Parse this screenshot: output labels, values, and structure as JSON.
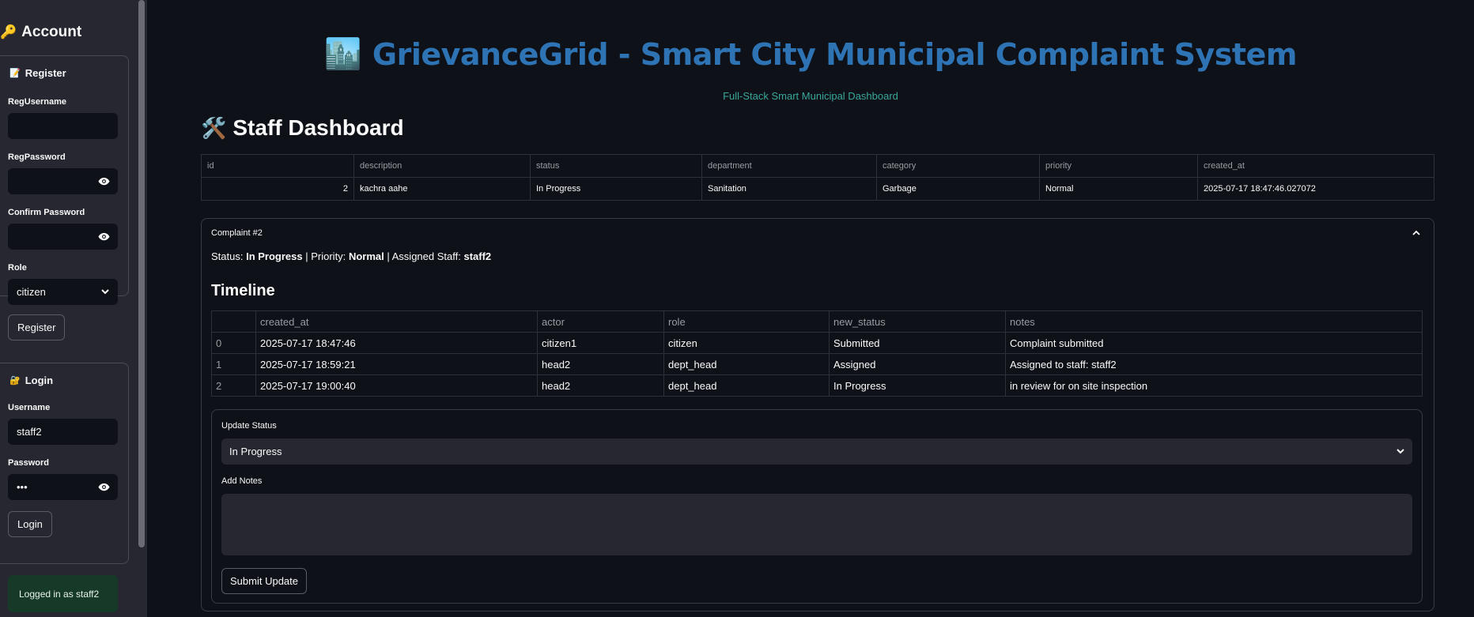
{
  "sidebar": {
    "title": "Account",
    "register": {
      "heading": "Register",
      "reg_username_label": "RegUsername",
      "reg_username_value": "",
      "reg_password_label": "RegPassword",
      "confirm_password_label": "Confirm Password",
      "role_label": "Role",
      "role_value": "citizen",
      "button": "Register"
    },
    "login": {
      "heading": "Login",
      "username_label": "Username",
      "username_value": "staff2",
      "password_label": "Password",
      "password_value": "•••",
      "button": "Login"
    },
    "status": "Logged in as staff2"
  },
  "header": {
    "title": "GrievanceGrid - Smart City Municipal Complaint System",
    "subtitle": "Full-Stack Smart Municipal Dashboard"
  },
  "dashboard": {
    "title": "Staff Dashboard",
    "complaints_table": {
      "columns": [
        "id",
        "description",
        "status",
        "department",
        "category",
        "priority",
        "created_at"
      ],
      "rows": [
        [
          "2",
          "kachra aahe",
          "In Progress",
          "Sanitation",
          "Garbage",
          "Normal",
          "2025-07-17 18:47:46.027072"
        ]
      ]
    }
  },
  "complaint": {
    "title": "Complaint #2",
    "status_label": "Status:",
    "status_value": "In Progress",
    "priority_label": "| Priority:",
    "priority_value": "Normal",
    "staff_label": "| Assigned Staff:",
    "staff_value": "staff2",
    "timeline_title": "Timeline",
    "timeline": {
      "columns": [
        "",
        "created_at",
        "actor",
        "role",
        "new_status",
        "notes"
      ],
      "rows": [
        [
          "0",
          "2025-07-17 18:47:46",
          "citizen1",
          "citizen",
          "Submitted",
          "Complaint submitted"
        ],
        [
          "1",
          "2025-07-17 18:59:21",
          "head2",
          "dept_head",
          "Assigned",
          "Assigned to staff: staff2"
        ],
        [
          "2",
          "2025-07-17 19:00:40",
          "head2",
          "dept_head",
          "In Progress",
          "in review for on site inspection"
        ]
      ]
    },
    "form": {
      "update_status_label": "Update Status",
      "update_status_value": "In Progress",
      "notes_label": "Add Notes",
      "notes_value": "",
      "submit_label": "Submit Update"
    }
  },
  "colors": {
    "title_blue": "#2e74b5",
    "subtitle_teal": "#3aa89b",
    "success_bg": "#173928",
    "sidebar_bg": "#262730",
    "page_bg": "#0e1117"
  }
}
